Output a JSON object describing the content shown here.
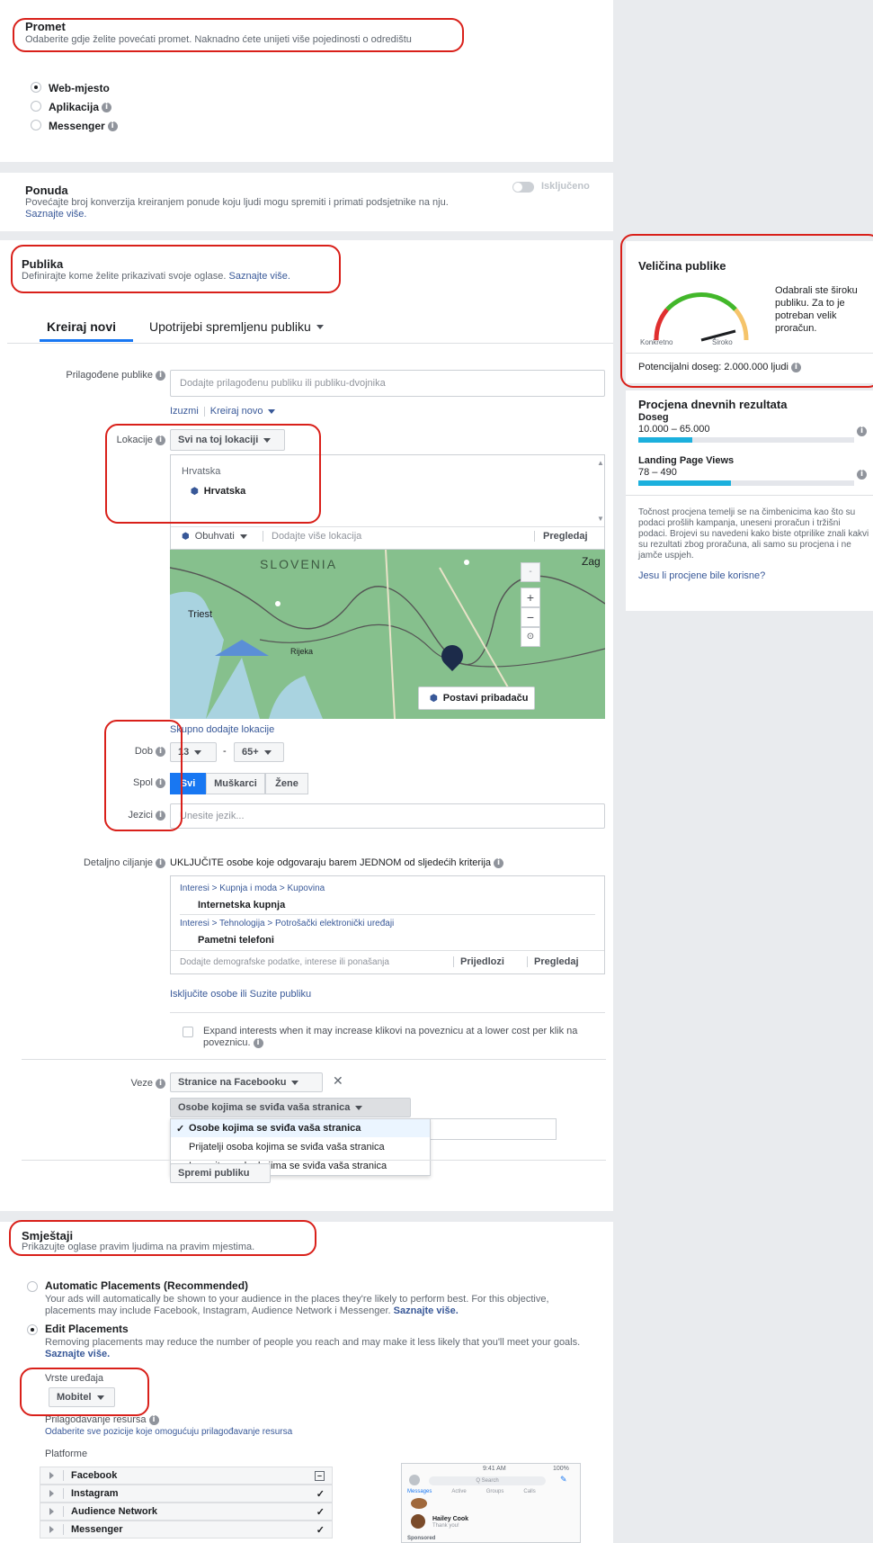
{
  "promet": {
    "title": "Promet",
    "subtitle": "Odaberite gdje želite povećati promet. Naknadno ćete unijeti više pojedinosti o odredištu",
    "options": [
      "Web-mjesto",
      "Aplikacija",
      "Messenger"
    ],
    "selected": "Web-mjesto"
  },
  "ponuda": {
    "title": "Ponuda",
    "desc": "Povećajte broj konverzija kreiranjem ponude koju ljudi mogu spremiti i primati podsjetnike na nju.",
    "learn_more": "Saznajte više.",
    "toggle_label": "Isključeno"
  },
  "publika": {
    "title": "Publika",
    "subtitle": "Definirajte kome želite prikazivati svoje oglase.",
    "learn_more": "Saznajte više.",
    "tabs": [
      "Kreiraj novi",
      "Upotrijebi spremljenu publiku"
    ],
    "custom_label": "Prilagođene publike",
    "custom_placeholder": "Dodajte prilagođenu publiku ili publiku-dvojnika",
    "exclude_link": "Izuzmi",
    "create_new_link": "Kreiraj novo",
    "locations_label": "Lokacije",
    "locations_dropdown": "Svi na toj lokaciji",
    "location_group": "Hrvatska",
    "location_item": "Hrvatska",
    "include_dropdown": "Obuhvati",
    "add_locations_placeholder": "Dodajte više lokacija",
    "browse": "Pregledaj",
    "map_labels": {
      "slovenia": "SLOVENIA",
      "trieste": "Triest",
      "rijeka": "Rijeka",
      "zagreb": "Zag"
    },
    "pin_button": "Postavi pribadaču",
    "bulk_add": "Skupno dodajte lokacije",
    "age_label": "Dob",
    "age_min": "13",
    "age_max": "65+",
    "age_sep": "-",
    "gender_label": "Spol",
    "genders": [
      "Svi",
      "Muškarci",
      "Žene"
    ],
    "lang_label": "Jezici",
    "lang_placeholder": "Unesite jezik...",
    "detailed_label": "Detaljno ciljanje",
    "detailed_header": "UKLJUČITE osobe koje odgovaraju barem JEDNOM od sljedećih kriterija",
    "interest1_path": "Interesi > Kupnja i moda > Kupovina",
    "interest1_item": "Internetska kupnja",
    "interest2_path": "Interesi > Tehnologija > Potrošački elektronički uređaji",
    "interest2_item": "Pametni telefoni",
    "detailed_placeholder": "Dodajte demografske podatke, interese ili ponašanja",
    "suggestions": "Prijedlozi",
    "browse2": "Pregledaj",
    "exclude_narrow": "Isključite osobe ili Suzite publiku",
    "expand_text": "Expand interests when it may increase klikovi na poveznicu at a lower cost per klik na poveznicu.",
    "connections_label": "Veze",
    "connections_dropdown": "Stranice na Facebooku",
    "connections_sub": "Osobe kojima se sviđa vaša stranica",
    "menu": [
      "Osobe kojima se sviđa vaša stranica",
      "Prijatelji osoba kojima se sviđa vaša stranica",
      "Izuzmite osobe kojima se sviđa vaša stranica"
    ],
    "save_button": "Spremi publiku"
  },
  "audience_size": {
    "title": "Veličina publike",
    "gauge_left": "Konkretno",
    "gauge_right": "Široko",
    "desc": "Odabrali ste široku publiku. Za to je potreban velik proračun.",
    "potential": "Potencijalni doseg: 2.000.000 ljudi"
  },
  "estimates": {
    "title": "Procjena dnevnih rezultata",
    "reach_label": "Doseg",
    "reach_value": "10.000 – 65.000",
    "reach_fill": 0.25,
    "lpv_label": "Landing Page Views",
    "lpv_value": "78 – 490",
    "lpv_fill": 0.43,
    "note": "Točnost procjena temelji se na čimbenicima kao što su podaci prošlih kampanja, uneseni proračun i tržišni podaci. Brojevi su navedeni kako biste otprilike znali kakvi su rezultati zbog proračuna, ali samo su procjena i ne jamče uspjeh.",
    "feedback": "Jesu li procjene bile korisne?"
  },
  "placements": {
    "title": "Smještaji",
    "subtitle": "Prikazujte oglase pravim ljudima na pravim mjestima.",
    "auto_title": "Automatic Placements (Recommended)",
    "auto_desc": "Your ads will automatically be shown to your audience in the places they're likely to perform best. For this objective, placements may include Facebook, Instagram, Audience Network i Messenger.",
    "auto_link": "Saznajte više.",
    "edit_title": "Edit Placements",
    "edit_desc": "Removing placements may reduce the number of people you reach and may make it less likely that you'll meet your goals.",
    "edit_link": "Saznajte više.",
    "device_label": "Vrste uređaja",
    "device_value": "Mobitel",
    "asset_label": "Prilagođavanje resursa",
    "asset_link": "Odaberite sve pozicije koje omogućuju prilagođavanje resursa",
    "platforms_label": "Platforme",
    "platforms": [
      "Facebook",
      "Instagram",
      "Audience Network",
      "Messenger"
    ]
  },
  "preview": {
    "tabs": [
      "Messages",
      "Active",
      "Groups",
      "Calls"
    ],
    "search": "Q Search",
    "person1": "Hailey Cook",
    "person1_sub": "Thank you!",
    "sponsored": "Sponsored",
    "time": "9:41 AM",
    "battery": "100%"
  },
  "colors": {
    "accent": "#1877f2",
    "link": "#385898",
    "highlight": "#d9201a",
    "bar": "#1cb0dd"
  }
}
